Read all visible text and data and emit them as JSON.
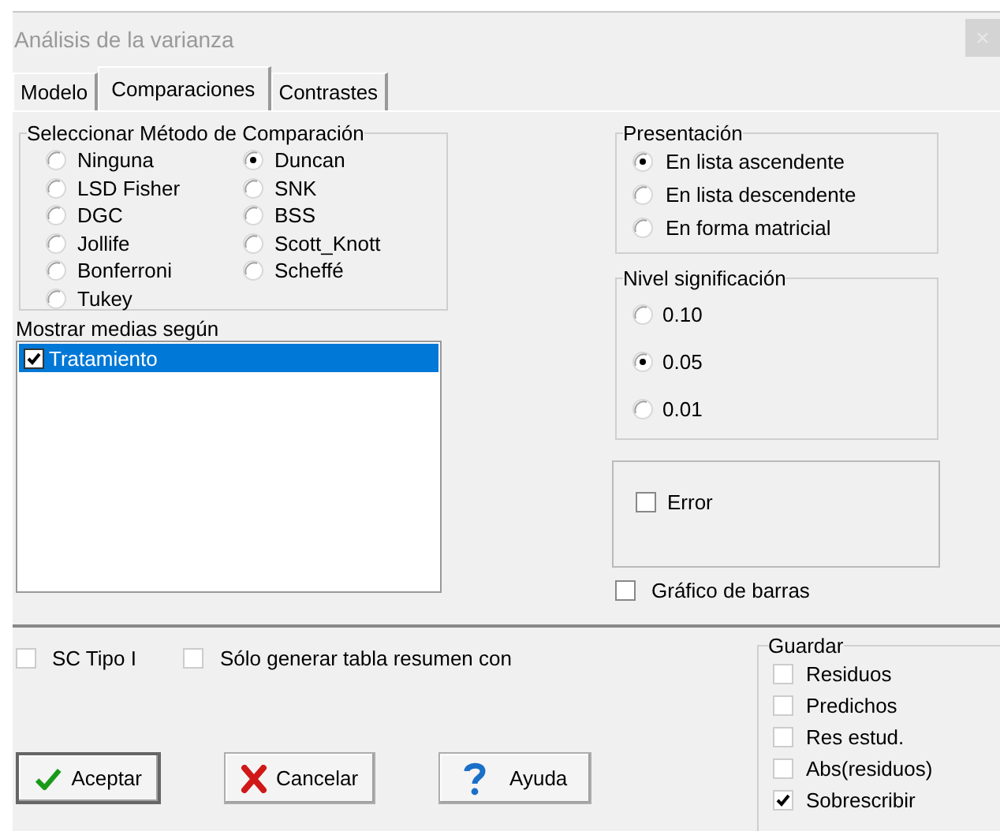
{
  "window": {
    "title": "Análisis de la varianza"
  },
  "tabs": [
    {
      "label": "Modelo",
      "selected": false
    },
    {
      "label": "Comparaciones",
      "selected": true
    },
    {
      "label": "Contrastes",
      "selected": false
    }
  ],
  "method_group": {
    "title": "Seleccionar Método de Comparación",
    "options": [
      {
        "label": "Ninguna",
        "selected": false
      },
      {
        "label": "LSD Fisher",
        "selected": false
      },
      {
        "label": "DGC",
        "selected": false
      },
      {
        "label": "Jollife",
        "selected": false
      },
      {
        "label": "Bonferroni",
        "selected": false
      },
      {
        "label": "Tukey",
        "selected": false
      },
      {
        "label": "Duncan",
        "selected": true
      },
      {
        "label": "SNK",
        "selected": false
      },
      {
        "label": "BSS",
        "selected": false
      },
      {
        "label": "Scott_Knott",
        "selected": false
      },
      {
        "label": "Scheffé",
        "selected": false
      }
    ]
  },
  "means_list": {
    "label": "Mostrar medias según",
    "items": [
      {
        "label": "Tratamiento",
        "checked": true,
        "selected": true
      }
    ]
  },
  "presentation_group": {
    "title": "Presentación",
    "options": [
      {
        "label": "En lista ascendente",
        "selected": true
      },
      {
        "label": "En lista descendente",
        "selected": false
      },
      {
        "label": "En forma matricial",
        "selected": false
      }
    ]
  },
  "significance_group": {
    "title": "Nivel significación",
    "options": [
      {
        "label": "0.10",
        "selected": false
      },
      {
        "label": "0.05",
        "selected": true
      },
      {
        "label": "0.01",
        "selected": false
      }
    ]
  },
  "error_checkbox": {
    "label": "Error",
    "checked": false
  },
  "bar_chart_checkbox": {
    "label": "Gráfico de barras",
    "checked": false
  },
  "bottom_checkboxes": [
    {
      "label": "SC Tipo I",
      "checked": false
    },
    {
      "label": "Sólo generar tabla resumen con",
      "checked": false
    }
  ],
  "buttons": [
    {
      "label": "Aceptar",
      "kind": "ok"
    },
    {
      "label": "Cancelar",
      "kind": "cancel"
    },
    {
      "label": "Ayuda",
      "kind": "help"
    }
  ],
  "save_group": {
    "title": "Guardar",
    "items": [
      {
        "label": "Residuos",
        "checked": false
      },
      {
        "label": "Predichos",
        "checked": false
      },
      {
        "label": "Res estud.",
        "checked": false
      },
      {
        "label": "Abs(residuos)",
        "checked": false
      },
      {
        "label": "Sobrescribir",
        "checked": true
      }
    ]
  }
}
